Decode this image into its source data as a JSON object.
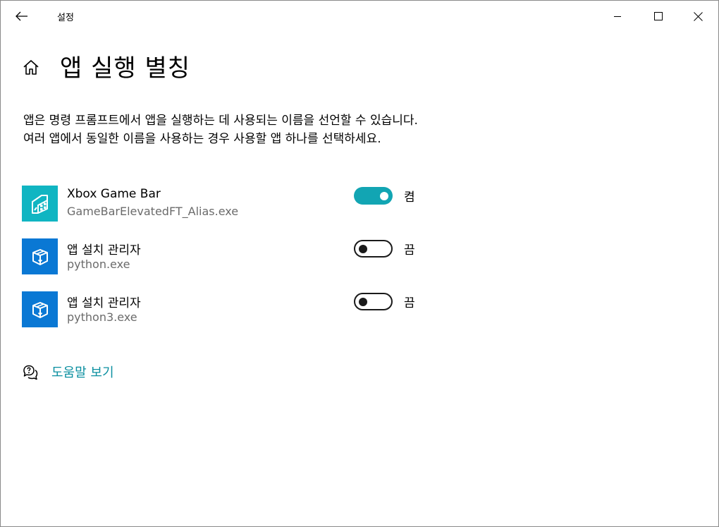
{
  "window": {
    "title": "설정",
    "controls": [
      "minimize-icon",
      "maximize-icon",
      "close-icon"
    ]
  },
  "page": {
    "title": "앱 실행 별칭",
    "description": "앱은 명령 프롬프트에서 앱을 실행하는 데 사용되는 이름을 선언할 수 있습니다. 여러 앱에서 동일한 이름을 사용하는 경우 사용할 앱 하나를 선택하세요."
  },
  "apps": [
    {
      "name": "Xbox Game Bar",
      "exe": "GameBarElevatedFT_Alias.exe",
      "state": "켬",
      "enabled": true,
      "icon": "xbox-game-bar-icon",
      "tile_color": "#10b5c2"
    },
    {
      "name": "앱 설치 관리자",
      "exe": "python.exe",
      "state": "끔",
      "enabled": false,
      "icon": "app-installer-icon",
      "tile_color": "#0a78d4"
    },
    {
      "name": "앱 설치 관리자",
      "exe": "python3.exe",
      "state": "끔",
      "enabled": false,
      "icon": "app-installer-icon",
      "tile_color": "#0a78d4"
    }
  ],
  "help": {
    "label": "도움말 보기",
    "icon": "help-chat-icon"
  },
  "colors": {
    "accent": "#12a5b3",
    "link": "#0b8fa0"
  }
}
